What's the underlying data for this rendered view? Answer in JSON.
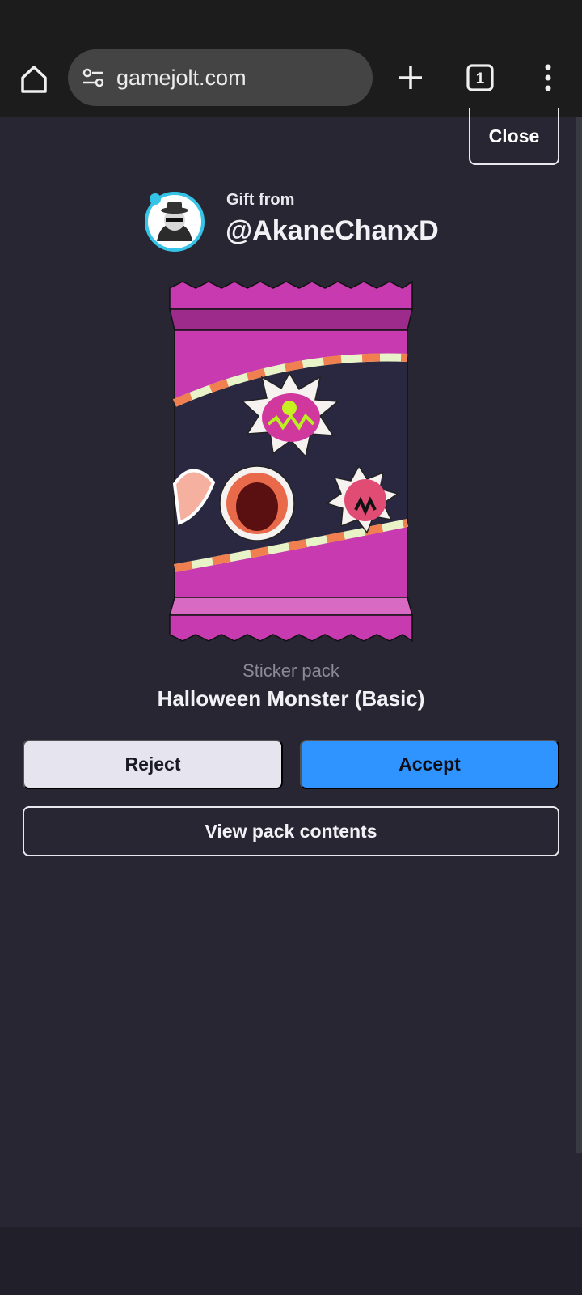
{
  "browser": {
    "url": "gamejolt.com",
    "tab_count": "1"
  },
  "modal": {
    "close_label": "Close",
    "gift_from_label": "Gift from",
    "sender": "@AkaneChanxD",
    "pack_type": "Sticker pack",
    "pack_name": "Halloween Monster (Basic)",
    "reject_label": "Reject",
    "accept_label": "Accept",
    "view_contents_label": "View pack contents"
  },
  "icons": [
    "home-icon",
    "site-settings-icon",
    "new-tab-icon",
    "tab-switcher-icon",
    "more-options-icon"
  ],
  "colors": {
    "background": "#282632",
    "accent": "#2f94ff",
    "reject": "#e6e4ee",
    "pack_magenta": "#c83ab0"
  }
}
